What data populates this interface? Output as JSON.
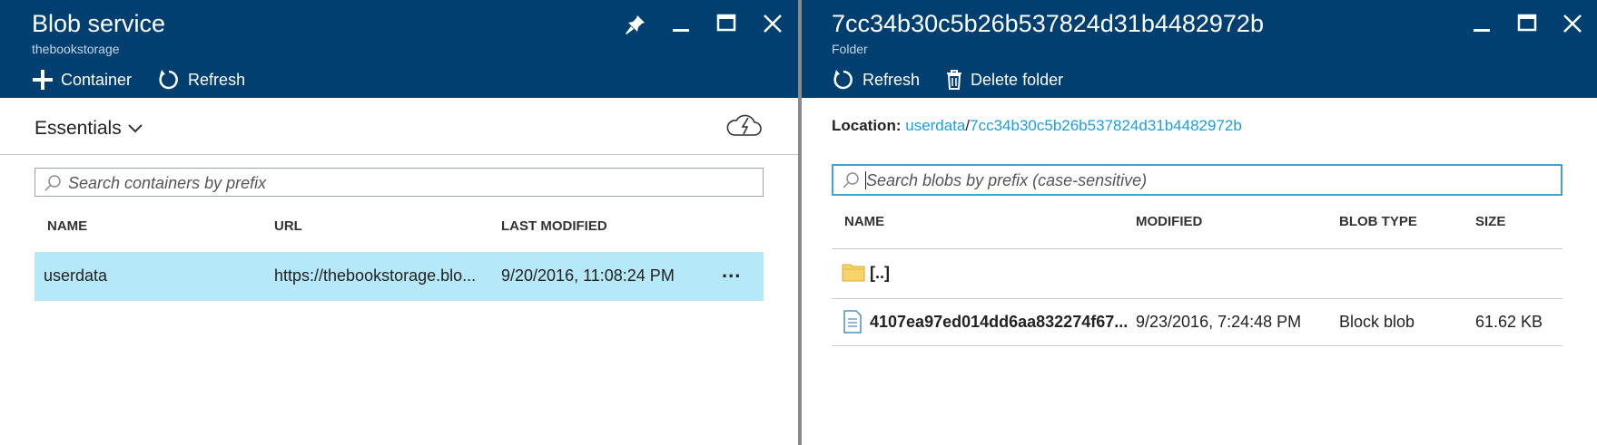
{
  "left_blade": {
    "title": "Blob service",
    "subtitle": "thebookstorage",
    "commands": {
      "container": "Container",
      "refresh": "Refresh"
    },
    "essentials": {
      "label": "Essentials"
    },
    "search": {
      "placeholder": "Search containers by prefix"
    },
    "table": {
      "columns": [
        "NAME",
        "URL",
        "LAST MODIFIED"
      ],
      "rows": [
        {
          "name": "userdata",
          "url": "https://thebookstorage.blo...",
          "modified": "9/20/2016, 11:08:24 PM",
          "more": "..."
        }
      ]
    }
  },
  "right_blade": {
    "title": "7cc34b30c5b26b537824d31b4482972b",
    "subtitle": "Folder",
    "commands": {
      "refresh": "Refresh",
      "delete_folder": "Delete folder"
    },
    "location": {
      "label": "Location:",
      "parts": [
        "userdata",
        "7cc34b30c5b26b537824d31b4482972b"
      ],
      "separator": "/"
    },
    "search": {
      "placeholder": "Search blobs by prefix (case-sensitive)"
    },
    "table": {
      "columns": [
        "NAME",
        "MODIFIED",
        "BLOB TYPE",
        "SIZE"
      ],
      "rows": [
        {
          "icon": "folder-icon",
          "name": "[..]",
          "modified": "",
          "blob_type": "",
          "size": ""
        },
        {
          "icon": "file-icon",
          "name": "4107ea97ed014dd6aa832274f67...",
          "modified": "9/23/2016, 7:24:48 PM",
          "blob_type": "Block blob",
          "size": "61.62 KB"
        }
      ]
    }
  },
  "colors": {
    "header_bg": "#003f70",
    "selected_row": "#b5e8f8",
    "link": "#1a9fdf",
    "focus_border": "#3ea5d7",
    "folder": "#f6d36b"
  }
}
